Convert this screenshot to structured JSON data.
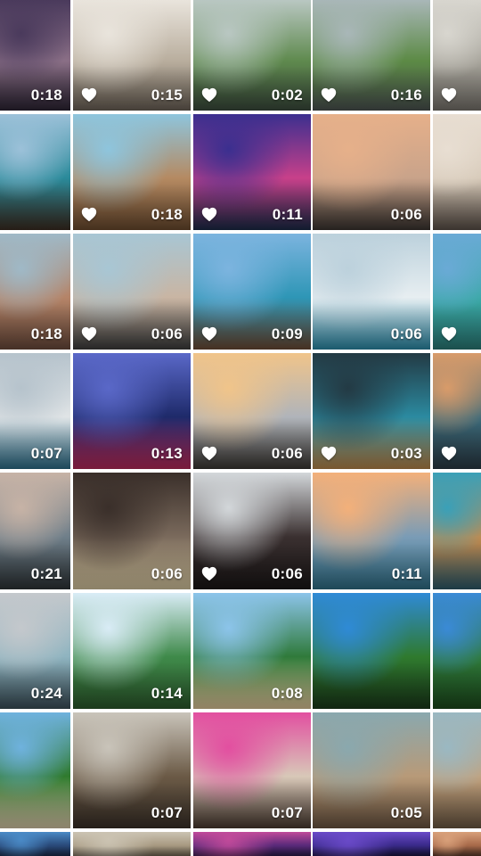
{
  "icons": {
    "favorite": "heart-icon"
  },
  "tiles": [
    {
      "duration": "0:18",
      "favorited": false,
      "colors": [
        "#4a3a5c",
        "#8a6f86",
        "#2c2433"
      ]
    },
    {
      "duration": "0:15",
      "favorited": true,
      "colors": [
        "#e9e4dc",
        "#b9ae9e",
        "#6b6156"
      ]
    },
    {
      "duration": "0:02",
      "favorited": true,
      "colors": [
        "#b9c7c2",
        "#5f8a4e",
        "#3a4a3c"
      ]
    },
    {
      "duration": "0:16",
      "favorited": true,
      "colors": [
        "#a9b7b8",
        "#5c8a45",
        "#4b5350"
      ]
    },
    {
      "duration": "",
      "favorited": true,
      "colors": [
        "#d8d6cf",
        "#a6a39a",
        "#77736c"
      ]
    },
    {
      "duration": "",
      "favorited": false,
      "colors": [
        "#9cc1d9",
        "#2a8a9a",
        "#3b2d22"
      ]
    },
    {
      "duration": "0:18",
      "favorited": true,
      "colors": [
        "#8ec5dd",
        "#b58a62",
        "#6a4a2e"
      ]
    },
    {
      "duration": "0:11",
      "favorited": true,
      "colors": [
        "#3b2f8f",
        "#c8408a",
        "#1b2a48"
      ]
    },
    {
      "duration": "0:06",
      "favorited": false,
      "colors": [
        "#e6b08a",
        "#c9a38a",
        "#3a3430"
      ]
    },
    {
      "duration": "",
      "favorited": false,
      "colors": [
        "#e8ded2",
        "#d6c9b8",
        "#5b5048"
      ]
    },
    {
      "duration": "0:18",
      "favorited": false,
      "colors": [
        "#9fb9c7",
        "#b58468",
        "#6a4a3b"
      ]
    },
    {
      "duration": "0:06",
      "favorited": true,
      "colors": [
        "#a8c6d4",
        "#c9b5a3",
        "#3b3b3b"
      ]
    },
    {
      "duration": "0:09",
      "favorited": true,
      "colors": [
        "#7cb4df",
        "#2e96b6",
        "#6b4a34"
      ]
    },
    {
      "duration": "0:06",
      "favorited": false,
      "colors": [
        "#bcd1dc",
        "#e7eef1",
        "#2a8aa8"
      ]
    },
    {
      "duration": "",
      "favorited": true,
      "colors": [
        "#6aaad6",
        "#3aa9a6",
        "#2a7a76"
      ]
    },
    {
      "duration": "0:07",
      "favorited": false,
      "colors": [
        "#b6c3cc",
        "#e0e4e6",
        "#2c6e8a"
      ]
    },
    {
      "duration": "0:13",
      "favorited": false,
      "colors": [
        "#5a68c8",
        "#1e2a6a",
        "#b82a5a"
      ]
    },
    {
      "duration": "0:06",
      "favorited": true,
      "colors": [
        "#f0c48a",
        "#b0b4ba",
        "#3a3632"
      ]
    },
    {
      "duration": "0:03",
      "favorited": true,
      "colors": [
        "#233a44",
        "#2b8aa0",
        "#b8864a"
      ]
    },
    {
      "duration": "",
      "favorited": true,
      "colors": [
        "#d89b6a",
        "#3b6a7a",
        "#2a3a44"
      ]
    },
    {
      "duration": "0:21",
      "favorited": false,
      "colors": [
        "#c7b3a6",
        "#6f7f8a",
        "#2d3336"
      ]
    },
    {
      "duration": "0:06",
      "favorited": false,
      "colors": [
        "#3a2f2a",
        "#7a6a5c",
        "#d8c8a0"
      ]
    },
    {
      "duration": "0:06",
      "favorited": true,
      "colors": [
        "#d3d7da",
        "#3a3030",
        "#1a1616"
      ]
    },
    {
      "duration": "0:11",
      "favorited": false,
      "colors": [
        "#f3b07a",
        "#7a9cb6",
        "#2f6e86"
      ]
    },
    {
      "duration": "",
      "favorited": false,
      "colors": [
        "#3aa0b8",
        "#c88a4a",
        "#2c5a6a"
      ]
    },
    {
      "duration": "0:24",
      "favorited": false,
      "colors": [
        "#c4c8cc",
        "#8fb4c0",
        "#3a4e58"
      ]
    },
    {
      "duration": "0:14",
      "favorited": false,
      "colors": [
        "#d9ecf6",
        "#3f8a4a",
        "#2c5a2c"
      ]
    },
    {
      "duration": "0:08",
      "favorited": false,
      "colors": [
        "#8cc4ea",
        "#2f7a3a",
        "#e0c89a"
      ]
    },
    {
      "duration": "",
      "favorited": false,
      "colors": [
        "#2f8ad6",
        "#2f7a2e",
        "#1a3a1a"
      ]
    },
    {
      "duration": "",
      "favorited": false,
      "colors": [
        "#3a8ad6",
        "#2f7a3a",
        "#1c4a1c"
      ]
    },
    {
      "duration": "",
      "favorited": false,
      "colors": [
        "#6fb2de",
        "#2f7a2e",
        "#d9c9a8"
      ]
    },
    {
      "duration": "0:07",
      "favorited": false,
      "colors": [
        "#c9c4ba",
        "#6b5a46",
        "#3a3028"
      ]
    },
    {
      "duration": "0:07",
      "favorited": false,
      "colors": [
        "#e24fa0",
        "#d8c8b8",
        "#4a3a30"
      ]
    },
    {
      "duration": "0:05",
      "favorited": false,
      "colors": [
        "#8aa8ae",
        "#b89a78",
        "#6a5440"
      ]
    },
    {
      "duration": "",
      "favorited": false,
      "colors": [
        "#9ab8c2",
        "#c2a27e",
        "#6c5842"
      ]
    },
    {
      "duration": "",
      "favorited": false,
      "colors": [
        "#4a8ac6",
        "#2a4a7a",
        "#1a2a4a"
      ]
    },
    {
      "duration": "",
      "favorited": false,
      "colors": [
        "#cbc3b2",
        "#a89a82",
        "#6e6350"
      ]
    },
    {
      "duration": "",
      "favorited": false,
      "colors": [
        "#c04a9a",
        "#5a2a7a",
        "#2a1a4a"
      ]
    },
    {
      "duration": "",
      "favorited": false,
      "colors": [
        "#6a4ac8",
        "#3a2a8a",
        "#1a1440"
      ]
    },
    {
      "duration": "",
      "favorited": false,
      "colors": [
        "#d8a07a",
        "#a86a4a",
        "#5a3a2a"
      ]
    }
  ]
}
